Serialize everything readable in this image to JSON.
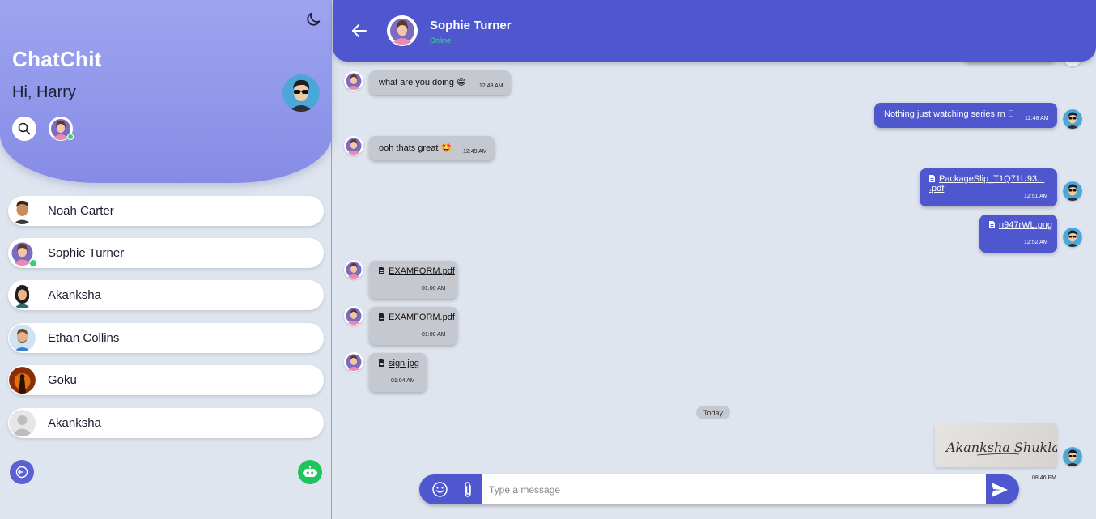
{
  "app": {
    "title": "ChatChit",
    "greeting": "Hi, Harry"
  },
  "contacts": [
    {
      "name": "Noah Carter"
    },
    {
      "name": "Sophie Turner",
      "online": true
    },
    {
      "name": "Akanksha"
    },
    {
      "name": "Ethan Collins"
    },
    {
      "name": "Goku"
    },
    {
      "name": "Akanksha"
    }
  ],
  "chat": {
    "name": "Sophie Turner",
    "status": "Online",
    "messages": [
      {
        "from": "them",
        "text": "what are you doing 😁",
        "time": "12:48 AM"
      },
      {
        "from": "me",
        "text": "Nothing just watching series rn ⃞",
        "time": "12:48 AM"
      },
      {
        "from": "them",
        "text": "ooh thats great 🤩",
        "time": "12:49 AM"
      },
      {
        "from": "me",
        "file": "PackageSlip_T1Q71U93... .pdf",
        "time": "12:51 AM"
      },
      {
        "from": "me",
        "file": "n947rWL.png",
        "time": "12:52 AM"
      },
      {
        "from": "them",
        "file": "EXAMFORM.pdf",
        "time": "01:00 AM"
      },
      {
        "from": "them",
        "file": "EXAMFORM.pdf",
        "time": "01:00 AM"
      },
      {
        "from": "them",
        "file": "sign.jpg",
        "time": "01:04 AM"
      }
    ],
    "divider": "Today",
    "signature_image": {
      "handwriting": "Akanksha Shukla",
      "time": "08:46 PM"
    }
  },
  "composer": {
    "placeholder": "Type a message"
  },
  "colors": {
    "primary": "#4f57cf",
    "header_gradient": "#9ea4ef",
    "online": "#3bd16f",
    "bot": "#1fc45a"
  },
  "icons": [
    "moon-icon",
    "search-icon",
    "back-arrow-icon",
    "file-icon",
    "emoji-icon",
    "paperclip-icon",
    "send-icon",
    "logout-icon",
    "bot-icon"
  ]
}
